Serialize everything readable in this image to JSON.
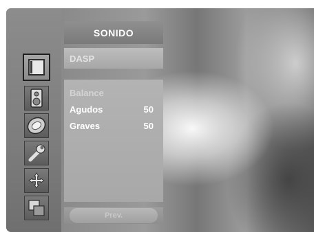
{
  "menu": {
    "title": "SONIDO",
    "dasp_label": "DASP",
    "items": [
      {
        "label": "Balance",
        "value": "",
        "highlighted": false
      },
      {
        "label": "Agudos",
        "value": "50",
        "highlighted": true
      },
      {
        "label": "Graves",
        "value": "50",
        "highlighted": true
      }
    ],
    "prev_label": "Prev."
  },
  "sidebar": {
    "icons": [
      "picture-icon",
      "speaker-icon",
      "clock-icon",
      "wrench-icon",
      "crosshair-icon",
      "pip-icon"
    ],
    "active_icon": "picture-icon"
  }
}
